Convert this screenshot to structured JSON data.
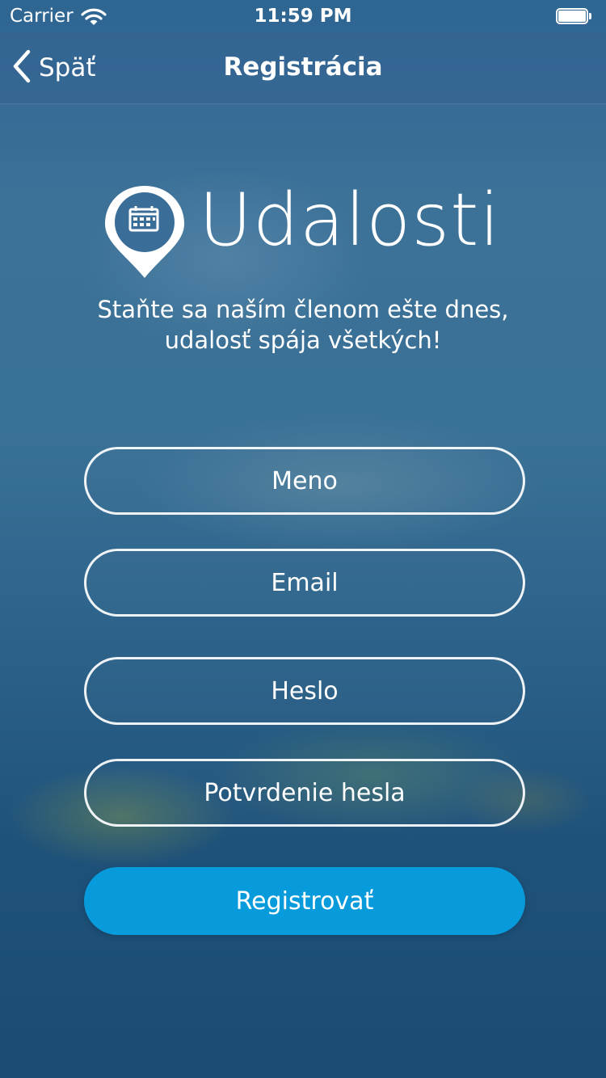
{
  "status_bar": {
    "carrier": "Carrier",
    "time": "11:59 PM"
  },
  "nav": {
    "back_label": "Späť",
    "title": "Registrácia"
  },
  "logo": {
    "app_name": "Udalosti",
    "icon": "calendar-pin-icon"
  },
  "tagline": {
    "line1": "Staňte sa naším členom ešte dnes,",
    "line2": "udalosť spája všetkých!"
  },
  "form": {
    "name_placeholder": "Meno",
    "email_placeholder": "Email",
    "password_placeholder": "Heslo",
    "confirm_placeholder": "Potvrdenie hesla",
    "submit_label": "Registrovať"
  },
  "colors": {
    "accent": "#079bdb",
    "background": "#2c628a"
  }
}
